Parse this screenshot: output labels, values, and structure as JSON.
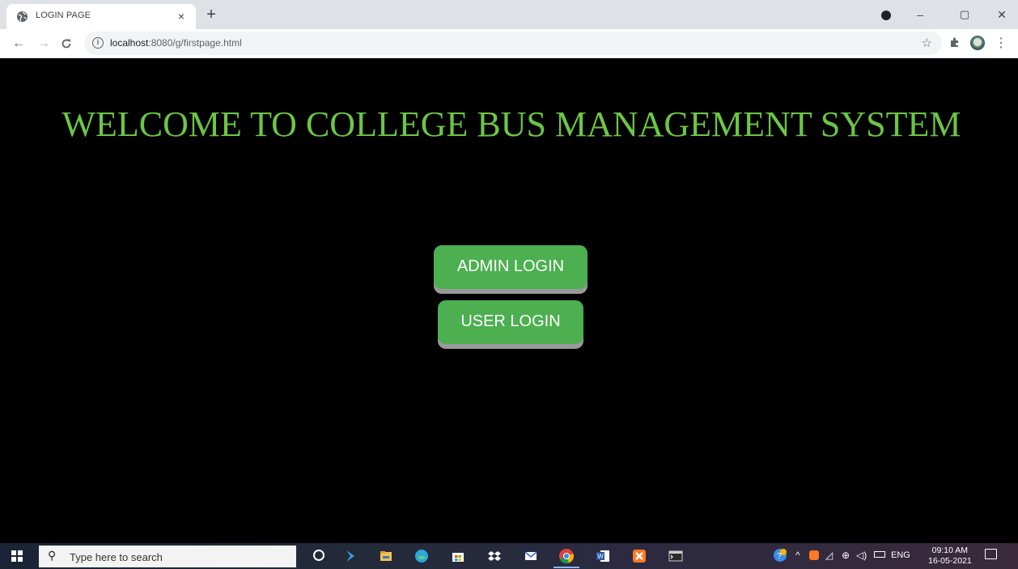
{
  "browser": {
    "tab_title": "LOGIN PAGE",
    "tab_close": "×",
    "new_tab": "+",
    "url_host": "localhost",
    "url_rest": ":8080/g/firstpage.html",
    "window_controls": {
      "minimize": "–",
      "restore": "▢",
      "close": "✕"
    }
  },
  "page": {
    "heading": "WELCOME TO COLLEGE BUS MANAGEMENT SYSTEM",
    "admin_button": "ADMIN LOGIN",
    "user_button": "USER LOGIN",
    "heading_color": "#6cc644",
    "button_color": "#4caf50"
  },
  "taskbar": {
    "search_placeholder": "Type here to search",
    "language": "ENG",
    "time": "09:10 AM",
    "date": "16-05-2021",
    "pinned_icons": [
      "cortana-icon",
      "visual-studio-icon",
      "file-explorer-icon",
      "edge-icon",
      "store-icon",
      "dropbox-icon",
      "mail-icon",
      "chrome-icon",
      "word-icon",
      "xampp-icon",
      "terminal-icon"
    ]
  }
}
